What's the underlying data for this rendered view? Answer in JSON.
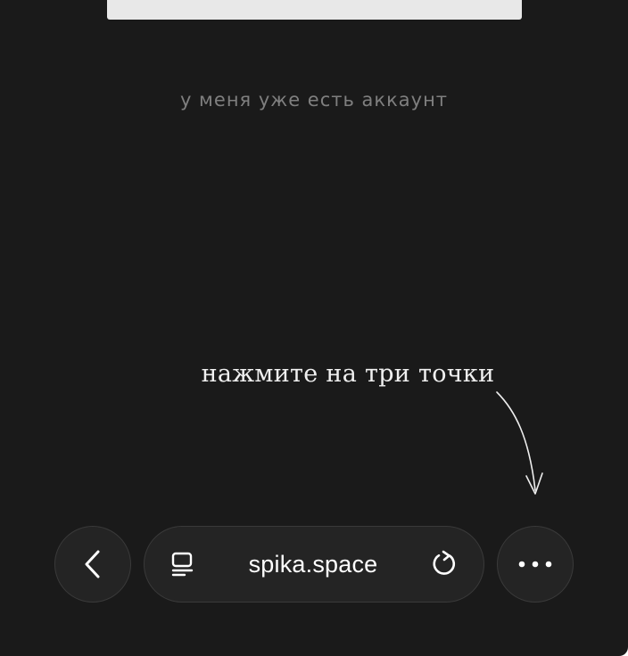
{
  "page": {
    "background": "#1a1a1a",
    "panel_color": "#e8e8e8"
  },
  "login": {
    "existing_account_label": "у меня уже есть аккаунт"
  },
  "hint": {
    "text": "нажмите на три точки",
    "arrow_icon": "hand-drawn-arrow-icon"
  },
  "toolbar": {
    "back_icon": "chevron-left-icon",
    "reader_icon": "reader-mode-icon",
    "url": "spika.space",
    "reload_icon": "reload-icon",
    "more_icon": "more-dots-icon"
  }
}
